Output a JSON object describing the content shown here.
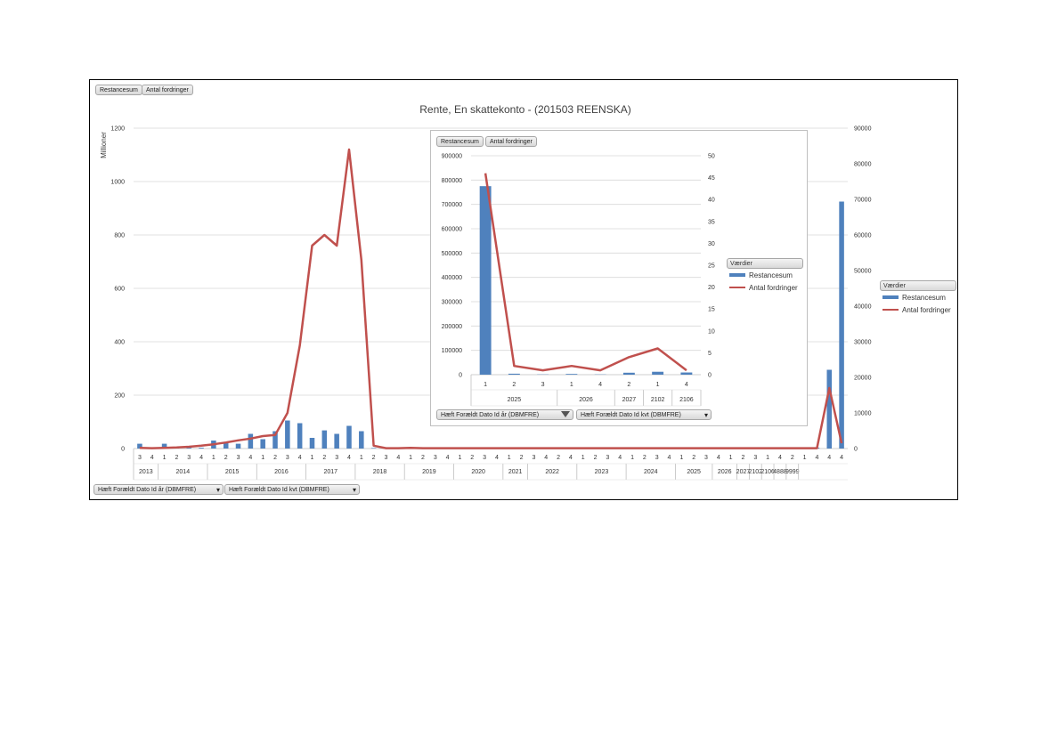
{
  "main": {
    "title": "Rente, En skattekonto - (201503 REENSKA)",
    "y_left_label": "Millioner",
    "top_buttons": [
      "Restancesum",
      "Antal fordringer"
    ],
    "bottom_dropdowns": [
      "Hæft Forældt Dato Id år (DBMFRE)",
      "Hæft Forældt Dato Id kvt (DBMFRE)"
    ],
    "legend_title": "Værdier",
    "legend": [
      "Restancesum",
      "Antal fordringer"
    ]
  },
  "inset": {
    "top_buttons": [
      "Restancesum",
      "Antal fordringer"
    ],
    "bottom_dropdowns": [
      "Hæft Forældt Dato Id år (DBMFRE)",
      "Hæft Forældt Dato Id kvt (DBMFRE)"
    ],
    "legend_title": "Værdier",
    "legend": [
      "Restancesum",
      "Antal fordringer"
    ]
  },
  "colors": {
    "bar": "#4f81bd",
    "line": "#c0504d",
    "grid": "#d9d9d9"
  },
  "chart_data": [
    {
      "type": "bar",
      "title": "Rente, En skattekonto - (201503 REENSKA)",
      "ylabel": "Millioner",
      "ylim": [
        0,
        1200
      ],
      "y2lim": [
        0,
        90000
      ],
      "yticks": [
        0,
        200,
        400,
        600,
        800,
        1000,
        1200
      ],
      "y2ticks": [
        0,
        10000,
        20000,
        30000,
        40000,
        50000,
        60000,
        70000,
        80000,
        90000
      ],
      "grid": true,
      "legend_position": "right",
      "quarters": [
        "3",
        "4",
        "1",
        "2",
        "3",
        "4",
        "1",
        "2",
        "3",
        "4",
        "1",
        "2",
        "3",
        "4",
        "1",
        "2",
        "3",
        "4",
        "1",
        "2",
        "3",
        "4",
        "1",
        "2",
        "3",
        "4",
        "1",
        "2",
        "3",
        "4",
        "1",
        "2",
        "3",
        "4",
        "2",
        "4",
        "1",
        "2",
        "3",
        "4",
        "1",
        "2",
        "3",
        "4",
        "1",
        "2",
        "3",
        "4",
        "1",
        "2",
        "3",
        "1",
        "4",
        "2",
        "1",
        "4",
        "4",
        "4"
      ],
      "years": [
        {
          "label": "2013",
          "span": 2
        },
        {
          "label": "2014",
          "span": 4
        },
        {
          "label": "2015",
          "span": 4
        },
        {
          "label": "2016",
          "span": 4
        },
        {
          "label": "2017",
          "span": 4
        },
        {
          "label": "2018",
          "span": 4
        },
        {
          "label": "2019",
          "span": 4
        },
        {
          "label": "2020",
          "span": 4
        },
        {
          "label": "2021",
          "span": 2
        },
        {
          "label": "2022",
          "span": 4
        },
        {
          "label": "2023",
          "span": 4
        },
        {
          "label": "2024",
          "span": 4
        },
        {
          "label": "2025",
          "span": 3
        },
        {
          "label": "2026",
          "span": 2
        },
        {
          "label": "2027",
          "span": 1
        },
        {
          "label": "2102",
          "span": 1
        },
        {
          "label": "2106",
          "span": 1
        },
        {
          "label": "4888",
          "span": 1
        },
        {
          "label": "9999",
          "span": 1
        }
      ],
      "series": [
        {
          "name": "Restancesum",
          "values": [
            18,
            3,
            18,
            3,
            3,
            3,
            30,
            20,
            18,
            55,
            35,
            65,
            105,
            95,
            40,
            68,
            55,
            85,
            65,
            2,
            2,
            2,
            1,
            1,
            1,
            1,
            1,
            1,
            1,
            1,
            1,
            1,
            1,
            1,
            1,
            1,
            1,
            1,
            1,
            1,
            1,
            1,
            1,
            1,
            1,
            1,
            1,
            1,
            1,
            1,
            1,
            1,
            1,
            1,
            2,
            3,
            295,
            925
          ]
        },
        {
          "name": "Antal fordringer",
          "values": [
            200,
            100,
            200,
            300,
            500,
            800,
            1200,
            1700,
            2300,
            2800,
            3500,
            3800,
            10000,
            29000,
            57000,
            60000,
            57000,
            84000,
            53000,
            800,
            100,
            100,
            200,
            100,
            100,
            100,
            100,
            100,
            100,
            100,
            100,
            100,
            100,
            100,
            100,
            100,
            100,
            100,
            100,
            100,
            100,
            100,
            100,
            100,
            100,
            100,
            100,
            100,
            100,
            100,
            100,
            100,
            100,
            100,
            100,
            100,
            17000,
            1500
          ]
        }
      ]
    },
    {
      "type": "bar",
      "ylim": [
        0,
        900000
      ],
      "y2lim": [
        0,
        50
      ],
      "yticks": [
        0,
        100000,
        200000,
        300000,
        400000,
        500000,
        600000,
        700000,
        800000,
        900000
      ],
      "y2ticks": [
        0,
        5,
        10,
        15,
        20,
        25,
        30,
        35,
        40,
        45,
        50
      ],
      "grid": true,
      "legend_position": "right",
      "quarters": [
        "1",
        "2",
        "3",
        "1",
        "4",
        "2",
        "1",
        "4"
      ],
      "years": [
        {
          "label": "2025",
          "span": 3
        },
        {
          "label": "2026",
          "span": 2
        },
        {
          "label": "2027",
          "span": 1
        },
        {
          "label": "2102",
          "span": 1
        },
        {
          "label": "2106",
          "span": 1
        }
      ],
      "series": [
        {
          "name": "Restancesum",
          "values": [
            775000,
            4000,
            1000,
            3000,
            1000,
            8000,
            12000,
            9000
          ]
        },
        {
          "name": "Antal fordringer",
          "values": [
            46,
            2,
            1,
            2,
            1,
            4,
            6,
            1
          ]
        }
      ]
    }
  ]
}
